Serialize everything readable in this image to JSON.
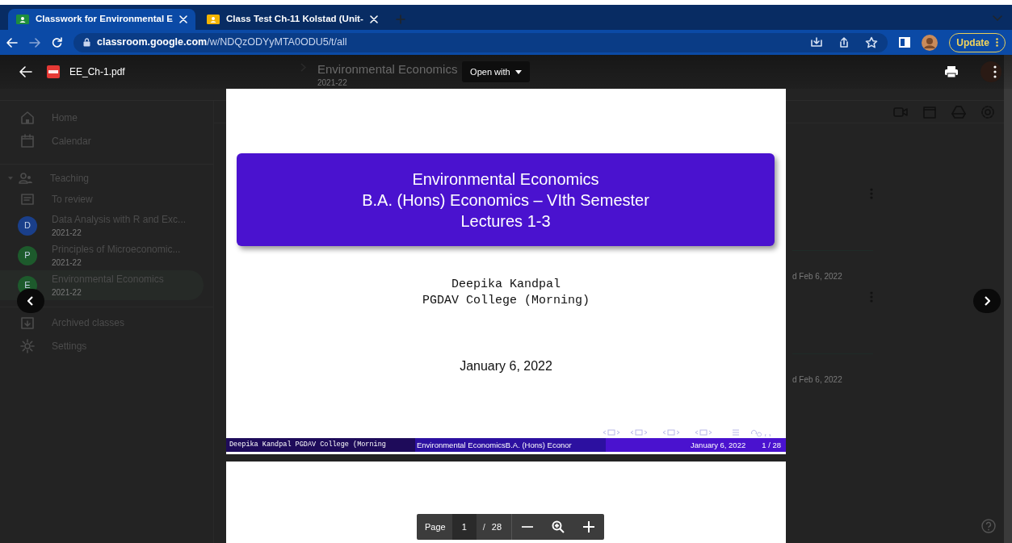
{
  "browser": {
    "tabs": [
      {
        "title": "Classwork for Environmental E",
        "selected": true
      },
      {
        "title": "Class Test Ch-11 Kolstad (Unit-",
        "selected": false
      }
    ],
    "url_host": "classroom.google.com",
    "url_path": "/w/NDQzODYyMTA0ODU5/t/all",
    "update_button": "Update"
  },
  "classroom": {
    "course_title": "Environmental Economics",
    "course_year": "2021-22",
    "sidebar": [
      {
        "kind": "nav",
        "label": "Home"
      },
      {
        "kind": "nav",
        "label": "Calendar"
      },
      {
        "kind": "section",
        "label": "Teaching",
        "expanded": true
      },
      {
        "kind": "nav",
        "label": "To review"
      },
      {
        "kind": "class",
        "initial": "D",
        "label": "Data Analysis with R and Exc...",
        "year": "2021-22",
        "color": "#1a3f8a",
        "selected": false
      },
      {
        "kind": "class",
        "initial": "P",
        "label": "Principles of Microeconomic...",
        "year": "2021-22",
        "color": "#1d5a2c",
        "selected": false
      },
      {
        "kind": "class",
        "initial": "E",
        "label": "Environmental Economics",
        "year": "2021-22",
        "color": "#1d5a2c",
        "selected": true
      },
      {
        "kind": "nav",
        "label": "Archived classes"
      },
      {
        "kind": "nav",
        "label": "Settings"
      }
    ],
    "cards": [
      {
        "meta": "d Feb 6, 2022"
      },
      {
        "meta": "d Feb 6, 2022"
      }
    ]
  },
  "viewer": {
    "file_name": "EE_Ch-1.pdf",
    "open_with": "Open with",
    "page_label": "Page",
    "page_input": "1",
    "page_separator": "/",
    "page_total": "28",
    "slide": {
      "title_lines": [
        "Environmental Economics",
        "B.A. (Hons) Economics – VIth Semester",
        "Lectures 1-3"
      ],
      "author": "Deepika Kandpal",
      "institute": "PGDAV College (Morning)",
      "date": "January 6, 2022",
      "footer": {
        "author": "Deepika Kandpal PGDAV College (Morning",
        "title": "Environmental EconomicsB.A. (Hons) Econor",
        "date": "January 6, 2022",
        "page": "1 / 28"
      }
    }
  }
}
